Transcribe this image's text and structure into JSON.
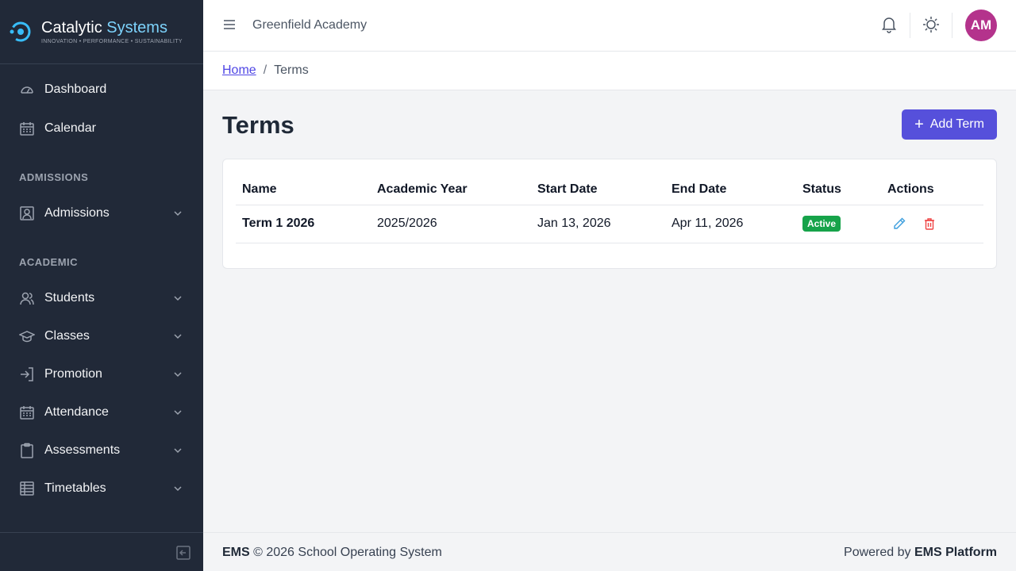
{
  "brand": {
    "name_part1": "Catalytic",
    "name_part2": "Systems",
    "tagline": "INNOVATION • PERFORMANCE • SUSTAINABILITY"
  },
  "sidebar": {
    "items_top": [
      {
        "label": "Dashboard",
        "icon": "gauge-icon"
      },
      {
        "label": "Calendar",
        "icon": "calendar-icon"
      }
    ],
    "section_admissions": "ADMISSIONS",
    "admissions_items": [
      {
        "label": "Admissions",
        "icon": "user-badge-icon"
      }
    ],
    "section_academic": "ACADEMIC",
    "academic_items": [
      {
        "label": "Students",
        "icon": "users-icon"
      },
      {
        "label": "Classes",
        "icon": "graduation-cap-icon"
      },
      {
        "label": "Promotion",
        "icon": "arrow-right-bracket-icon"
      },
      {
        "label": "Attendance",
        "icon": "calendar-grid-icon"
      },
      {
        "label": "Assessments",
        "icon": "clipboard-icon"
      },
      {
        "label": "Timetables",
        "icon": "table-icon"
      }
    ]
  },
  "header": {
    "school_name": "Greenfield Academy",
    "avatar_initials": "AM"
  },
  "breadcrumb": {
    "home": "Home",
    "separator": "/",
    "current": "Terms"
  },
  "main": {
    "title": "Terms",
    "add_button": "Add Term",
    "table": {
      "columns": [
        "Name",
        "Academic Year",
        "Start Date",
        "End Date",
        "Status",
        "Actions"
      ],
      "rows": [
        {
          "name": "Term 1 2026",
          "academic_year": "2025/2026",
          "start_date": "Jan 13, 2026",
          "end_date": "Apr 11, 2026",
          "status": "Active"
        }
      ]
    }
  },
  "footer": {
    "left_brand": "EMS",
    "left_text": "© 2026 School Operating System",
    "right_prefix": "Powered by",
    "right_brand": "EMS Platform"
  },
  "colors": {
    "sidebar_bg": "#212938",
    "accent": "#5650db",
    "active_badge": "#16a34a",
    "avatar": "#b4338c"
  }
}
